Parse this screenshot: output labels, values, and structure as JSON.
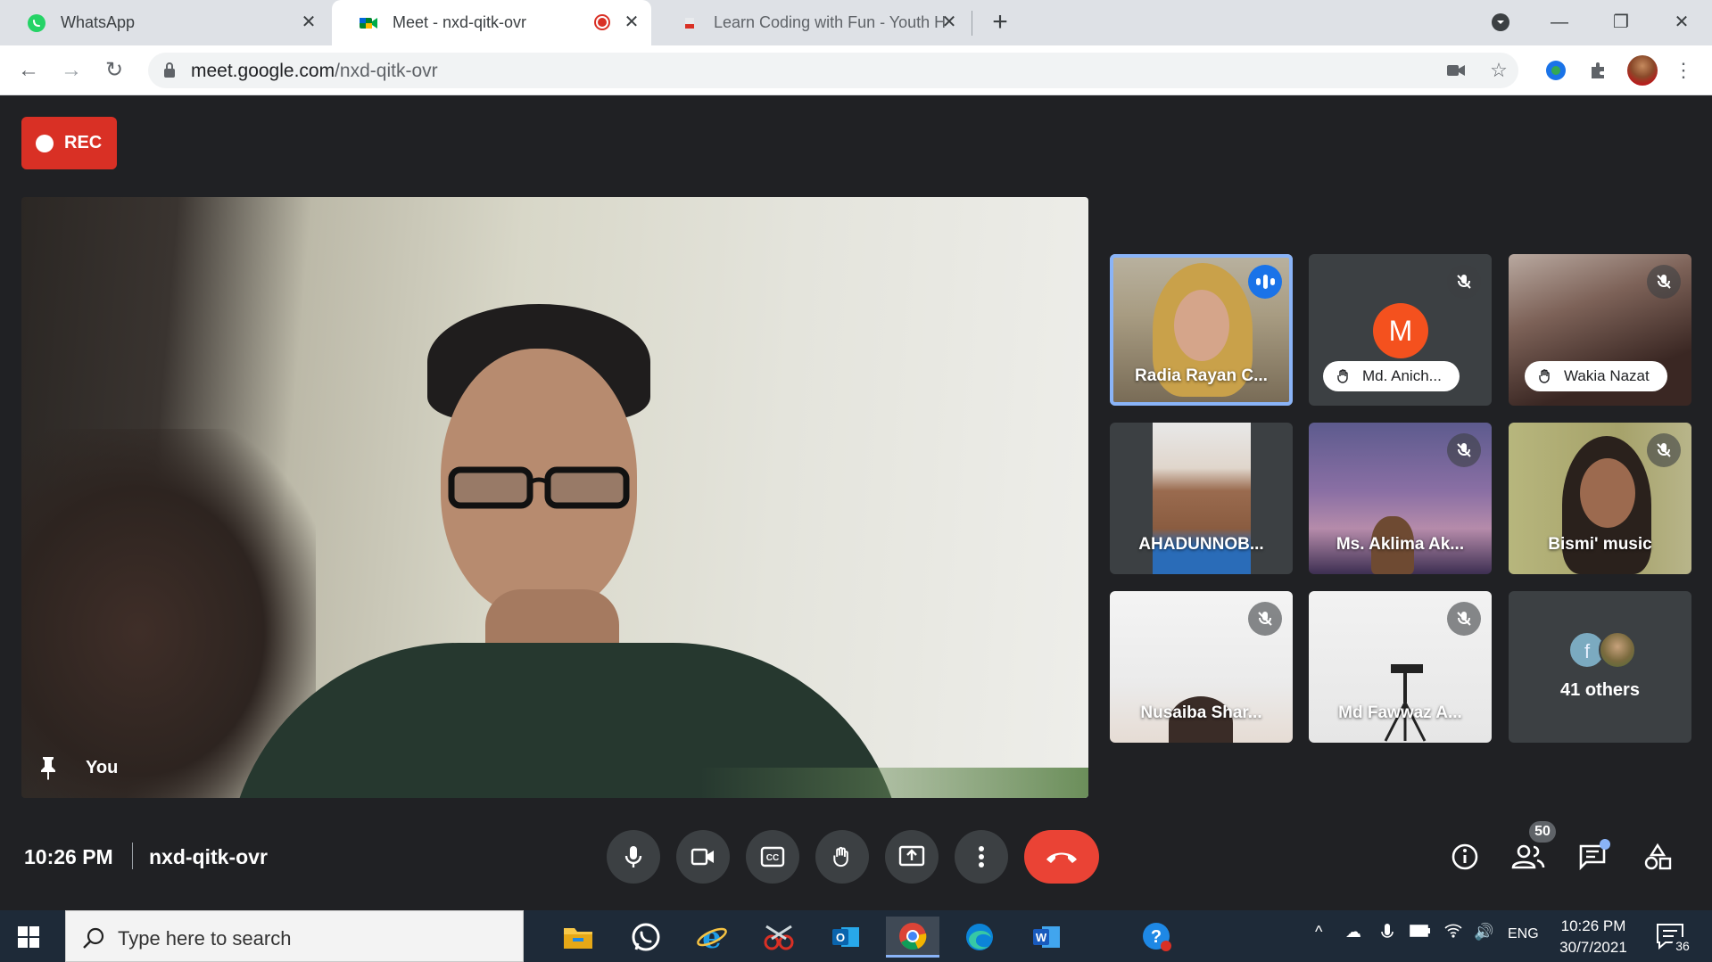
{
  "browser": {
    "tabs": [
      {
        "title": "WhatsApp",
        "icon": "whatsapp-icon",
        "active": false
      },
      {
        "title": "Meet - nxd-qitk-ovr",
        "icon": "google-meet-icon",
        "active": true,
        "recording": true
      },
      {
        "title": "Learn Coding with Fun - Youth H",
        "icon": "site-favicon",
        "active": false
      }
    ],
    "url_host": "meet.google.com",
    "url_path": "/nxd-qitk-ovr"
  },
  "meet": {
    "rec_label": "REC",
    "self_label": "You",
    "participants": [
      {
        "name": "Radia Rayan C...",
        "state": "speaking"
      },
      {
        "name": "Md. Anich...",
        "state": "muted",
        "hand_raised": true,
        "avatar_letter": "M",
        "avatar_color": "#f4511e"
      },
      {
        "name": "Wakia Nazat",
        "state": "muted",
        "hand_raised": true
      },
      {
        "name": "AHADUNNOB...",
        "state": "unmuted"
      },
      {
        "name": "Ms. Aklima Ak...",
        "state": "muted"
      },
      {
        "name": "Bismi' music",
        "state": "muted"
      },
      {
        "name": "Nusaiba Shar...",
        "state": "muted"
      },
      {
        "name": "Md Fawwaz A...",
        "state": "muted"
      }
    ],
    "others": {
      "avatar_letter": "f",
      "label": "41 others"
    },
    "time": "10:26 PM",
    "code": "nxd-qitk-ovr",
    "people_count": "50",
    "end_call_color": "#ea4335"
  },
  "taskbar": {
    "search_placeholder": "Type here to search",
    "language": "ENG",
    "time": "10:26 PM",
    "date": "30/7/2021",
    "notification_count": "36"
  }
}
